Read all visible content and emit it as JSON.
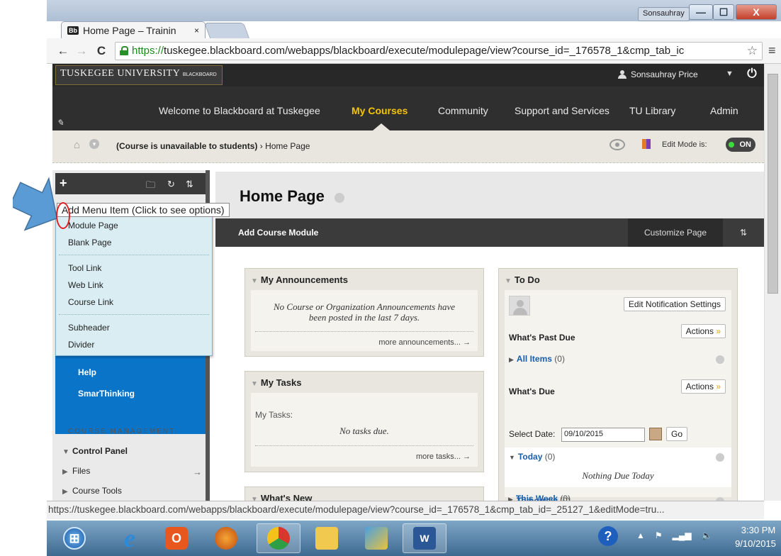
{
  "browser": {
    "tab_title": "Home Page – Trainin",
    "tab_badge": "Bb",
    "tab_close": "×",
    "window_user": "Sonsauhray",
    "url_scheme": "https://",
    "url_rest": "tuskegee.blackboard.com/webapps/blackboard/execute/modulepage/view?course_id=_176578_1&cmp_tab_ic",
    "status_url": "https://tuskegee.blackboard.com/webapps/blackboard/execute/modulepage/view?course_id=_176578_1&cmp_tab_id=_25127_1&editMode=tru..."
  },
  "header": {
    "logo_text": "TUSKEGEE UNIVERSITY",
    "logo_sub": "BLACKBOARD",
    "user_name": "Sonsauhray Price",
    "tabs": [
      {
        "label": "Welcome to Blackboard at Tuskegee",
        "active": false
      },
      {
        "label": "My Courses",
        "active": true
      },
      {
        "label": "Community",
        "active": false
      },
      {
        "label": "Support and Services",
        "active": false
      },
      {
        "label": "TU Library",
        "active": false
      },
      {
        "label": "Admin",
        "active": false
      }
    ]
  },
  "breadcrumb": {
    "status": "(Course is unavailable to students)",
    "separator": "›",
    "current": "Home Page",
    "edit_mode_label": "Edit Mode is:",
    "edit_mode_value": "ON"
  },
  "leftnav": {
    "tooltip": "Add Menu Item (Click to see options)",
    "menu_groups": [
      [
        "Module Page",
        "Blank Page"
      ],
      [
        "Tool Link",
        "Web Link",
        "Course Link"
      ],
      [
        "Subheader",
        "Divider"
      ]
    ],
    "course_links": [
      "Help",
      "SmarThinking"
    ],
    "course_management_heading": "COURSE MANAGEMENT",
    "control_panel": "Control Panel",
    "cm_items": [
      "Files",
      "Course Tools"
    ]
  },
  "content": {
    "page_title": "Home Page",
    "add_module": "Add Course Module",
    "customize": "Customize Page",
    "announcements": {
      "title": "My Announcements",
      "empty": "No Course or Organization Announcements have been posted in the last 7 days.",
      "more": "more announcements... →"
    },
    "tasks": {
      "title": "My Tasks",
      "label": "My Tasks:",
      "empty": "No tasks due.",
      "more": "more tasks... →"
    },
    "whats_new": {
      "title": "What's New"
    },
    "todo": {
      "title": "To Do",
      "edit_notifications": "Edit Notification Settings",
      "past_due_heading": "What's Past Due",
      "actions_label": "Actions",
      "all_items": "All Items",
      "all_items_count": "(0)",
      "due_heading": "What's Due",
      "select_date_label": "Select Date:",
      "date_value": "09/10/2015",
      "go": "Go",
      "today": "Today",
      "today_count": "(0)",
      "nothing_today": "Nothing Due Today",
      "tomorrow": "Tomorrow",
      "tomorrow_count": "(0)",
      "this_week": "This Week",
      "this_week_count": "(0)"
    }
  },
  "taskbar": {
    "time": "3:30 PM",
    "date": "9/10/2015"
  }
}
